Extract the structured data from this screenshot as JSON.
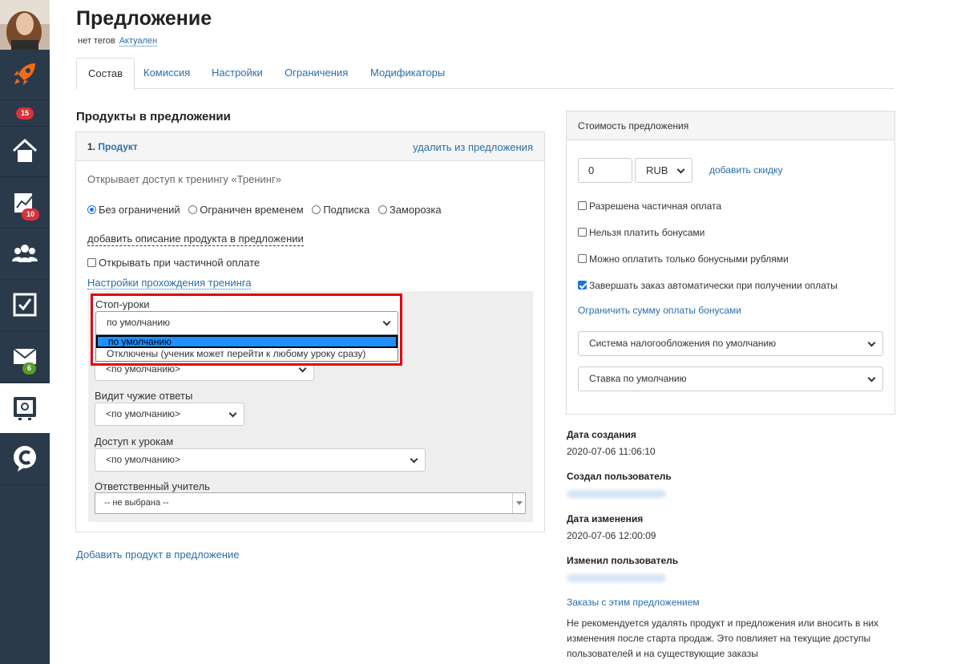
{
  "sidebar": {
    "badges": {
      "top": "15",
      "chart": "10",
      "mail": "6"
    }
  },
  "header": {
    "title": "Предложение",
    "tags": "нет тегов",
    "status": "Актуален"
  },
  "tabs": [
    "Состав",
    "Комиссия",
    "Настройки",
    "Ограничения",
    "Модификаторы"
  ],
  "products": {
    "section_title": "Продукты в предложении",
    "item_number": "1.",
    "item_name": "Продукт",
    "delete_label": "удалить из предложения",
    "access_text": "Открывает доступ к тренингу «Тренинг»",
    "radio_options": [
      "Без ограничений",
      "Ограничен временем",
      "Подписка",
      "Заморозка"
    ],
    "add_description": "добавить описание продукта в предложении",
    "open_partial": "Открывать при частичной оплате",
    "training_settings": "Настройки прохождения тренинга",
    "stop_lessons_label": "Стоп-уроки",
    "stop_lessons_value": "по умолчанию",
    "dropdown_options": [
      "по умолчанию",
      "Отключены (ученик может перейти к любому уроку сразу)"
    ],
    "hidden_select_value": "<по умолчанию>",
    "sees_answers_label": "Видит чужие ответы",
    "sees_answers_value": "<по умолчанию>",
    "lessons_access_label": "Доступ к урокам",
    "lessons_access_value": "<по умолчанию>",
    "teacher_label": "Ответственный учитель",
    "teacher_value": "-- не выбрана --",
    "add_product": "Добавить продукт в предложение"
  },
  "pricing": {
    "title": "Стоимость предложения",
    "price": "0",
    "currency": "RUB",
    "add_discount": "добавить скидку",
    "checkboxes": [
      {
        "label": "Разрешена частичная оплата",
        "checked": false
      },
      {
        "label": "Нельзя платить бонусами",
        "checked": false
      },
      {
        "label": "Можно оплатить только бонусными рублями",
        "checked": false
      },
      {
        "label": "Завершать заказ автоматически при получении оплаты",
        "checked": true
      }
    ],
    "limit_bonus": "Ограничить сумму оплаты бонусами",
    "tax_system": "Система налогообложения по умолчанию",
    "tax_rate": "Ставка по умолчанию"
  },
  "meta": {
    "created_label": "Дата создания",
    "created_value": "2020-07-06 11:06:10",
    "created_by_label": "Создал пользователь",
    "modified_label": "Дата изменения",
    "modified_value": "2020-07-06 12:00:09",
    "modified_by_label": "Изменил пользователь",
    "orders_link": "Заказы с этим предложением",
    "note": "Не рекомендуется удалять продукт и предложения или вносить в них изменения после старта продаж. Это повлияет на текущие доступы пользователей и на существующие заказы"
  }
}
